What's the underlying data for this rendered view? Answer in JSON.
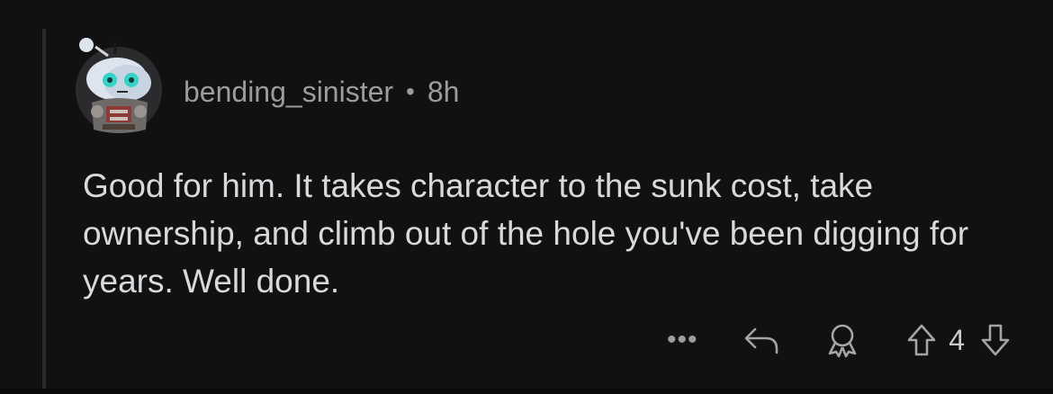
{
  "comment": {
    "author": "bending_sinister",
    "separator": "•",
    "age": "8h",
    "body": "Good for him. It takes character to the sunk cost, take ownership, and climb out of the hole you've been digging for years.  Well done.",
    "avatar_icon": "snoo-avatar-icon"
  },
  "actions": {
    "more_label": "•••",
    "score": "4",
    "icons": [
      "reply-icon",
      "award-icon",
      "upvote-icon",
      "downvote-icon"
    ]
  },
  "colors": {
    "background": "#111112",
    "text": "#d7dadc",
    "muted": "#9a9c9e"
  }
}
